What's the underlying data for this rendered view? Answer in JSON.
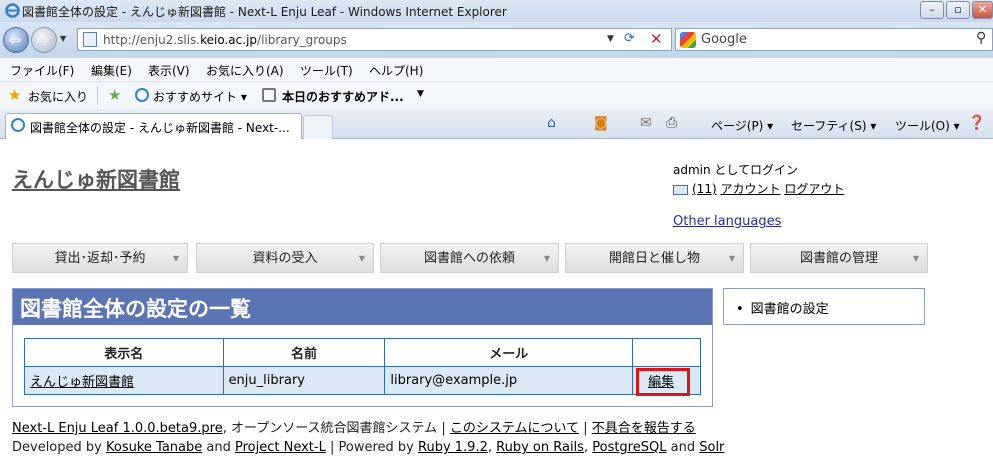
{
  "window": {
    "title": "図書館全体の設定 - えんじゅ新図書館 - Next-L Enju Leaf - Windows Internet Explorer",
    "min": "–",
    "max": "▫",
    "close": "✕"
  },
  "address": {
    "url_prefix": "http://enju2.slis.",
    "url_host": "keio.ac.jp",
    "url_suffix": "/library_groups"
  },
  "search": {
    "placeholder": "Google"
  },
  "menu": [
    "ファイル(F)",
    "編集(E)",
    "表示(V)",
    "お気に入り(A)",
    "ツール(T)",
    "ヘルプ(H)"
  ],
  "favorites": {
    "favorites_label": "お気に入り",
    "suggested_sites": "おすすめサイト ▾",
    "today": "本日のおすすめアド..."
  },
  "tab": {
    "title": "図書館全体の設定 - えんじゅ新図書館 - Next-..."
  },
  "commands": {
    "page": "ページ(P) ▾",
    "safety": "セーフティ(S) ▾",
    "tools": "ツール(O) ▾"
  },
  "site": {
    "title": "えんじゅ新図書館",
    "login_status": "admin としてログイン",
    "messages": "(11)",
    "account": "アカウント",
    "logout": "ログアウト",
    "other_languages": "Other languages"
  },
  "nav": [
    "貸出･返却･予約",
    "資料の受入",
    "図書館への依頼",
    "開館日と催し物",
    "図書館の管理"
  ],
  "main": {
    "heading": "図書館全体の設定の一覧",
    "columns": [
      "表示名",
      "名前",
      "メール",
      ""
    ],
    "rows": [
      {
        "display_name": "えんじゅ新図書館",
        "name": "enju_library",
        "email": "library@example.jp",
        "action": "編集"
      }
    ]
  },
  "sidebar": {
    "items": [
      "図書館の設定"
    ]
  },
  "footer": {
    "product": "Next-L Enju Leaf 1.0.0.beta9.pre",
    "desc": ", オープンソース統合図書館システム",
    "sep": "|",
    "about": "このシステムについて",
    "report": "不具合を報告する",
    "developed_by": "Developed by",
    "author": "Kosuke Tanabe",
    "and": "and",
    "project": "Project Next-L",
    "powered_by": "Powered by",
    "ruby": "Ruby 1.9.2",
    "comma": ",",
    "rails": "Ruby on Rails",
    "postgres": "PostgreSQL",
    "solr": "Solr"
  }
}
